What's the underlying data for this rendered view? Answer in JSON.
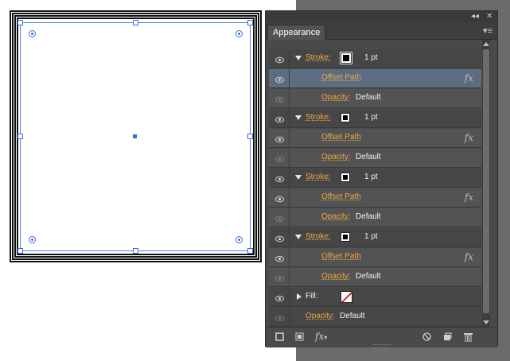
{
  "panel": {
    "tab_label": "Appearance",
    "collapse_label": "◂◂",
    "close_label": "✕",
    "menu_label": "▾≡"
  },
  "colors": {
    "accent_label": "#f0a646",
    "selected_row": "#5d6d81",
    "panel_bg": "#4a4a4a",
    "selection": "#3b6fd6"
  },
  "rows": [
    {
      "kind": "stroke",
      "label": "Stroke:",
      "value": "1 pt",
      "expanded": true
    },
    {
      "kind": "effect",
      "label": "Offset Path",
      "fx": "fx",
      "selected": true
    },
    {
      "kind": "opacity",
      "label": "Opacity:",
      "value": "Default"
    },
    {
      "kind": "stroke",
      "label": "Stroke:",
      "value": "1 pt",
      "expanded": true
    },
    {
      "kind": "effect",
      "label": "Offset Path",
      "fx": "fx"
    },
    {
      "kind": "opacity",
      "label": "Opacity:",
      "value": "Default"
    },
    {
      "kind": "stroke",
      "label": "Stroke:",
      "value": "1 pt",
      "expanded": true
    },
    {
      "kind": "effect",
      "label": "Offset Path",
      "fx": "fx"
    },
    {
      "kind": "opacity",
      "label": "Opacity:",
      "value": "Default"
    },
    {
      "kind": "stroke",
      "label": "Stroke:",
      "value": "1 pt",
      "expanded": true
    },
    {
      "kind": "effect",
      "label": "Offset Path",
      "fx": "fx"
    },
    {
      "kind": "opacity",
      "label": "Opacity:",
      "value": "Default"
    },
    {
      "kind": "fill",
      "label": "Fill:"
    },
    {
      "kind": "opacity_top",
      "label": "Opacity:",
      "value": "Default"
    }
  ],
  "footer": {
    "add_stroke": "add-new-stroke-icon",
    "add_fill": "add-new-fill-icon",
    "fx_label": "fx",
    "clear": "clear-appearance-icon",
    "duplicate": "duplicate-item-icon",
    "delete": "delete-icon"
  }
}
